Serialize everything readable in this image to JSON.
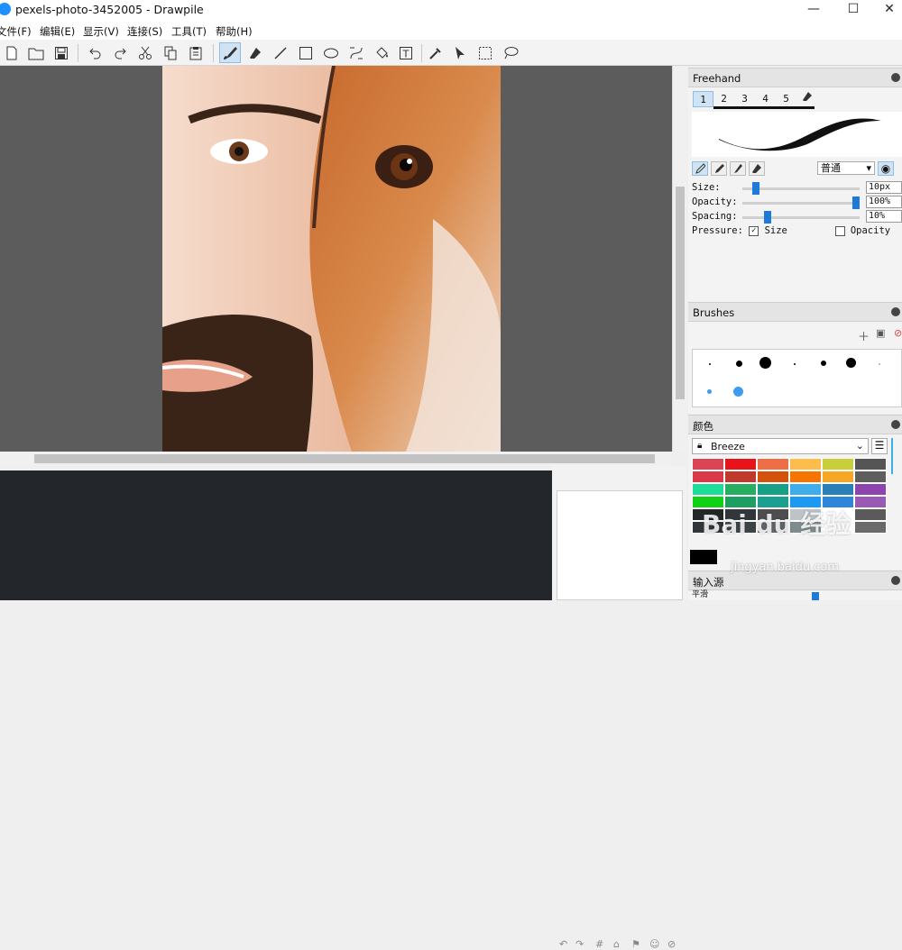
{
  "window": {
    "title": "pexels-photo-3452005 - Drawpile",
    "minimize": "—",
    "maximize": "☐",
    "close": "✕"
  },
  "menu": [
    "文件(F)",
    "编辑(E)",
    "显示(V)",
    "连接(S)",
    "工具(T)",
    "帮助(H)"
  ],
  "toolbar": {
    "file_tools": [
      "new-document",
      "open-folder",
      "save"
    ],
    "edit_tools": [
      "undo",
      "redo",
      "cut",
      "copy",
      "paste"
    ],
    "draw_tools": [
      "freehand-brush",
      "eraser",
      "line",
      "rectangle",
      "ellipse",
      "bezier",
      "flood-fill",
      "text"
    ],
    "misc_tools": [
      "color-picker",
      "pointer",
      "selection",
      "lasso"
    ],
    "active_tool": "freehand-brush",
    "text_tool_glyph": "T"
  },
  "freehand": {
    "title": "Freehand",
    "tabs": [
      "1",
      "2",
      "3",
      "4",
      "5"
    ],
    "active_tab": "1",
    "blend_mode": "普通",
    "size_label": "Size:",
    "size_value": "10px",
    "size_level": 0.09,
    "opacity_label": "Opacity:",
    "opacity_value": "100%",
    "opacity_level": 1.0,
    "spacing_label": "Spacing:",
    "spacing_value": "10%",
    "spacing_level": 0.2,
    "pressure_label": "Pressure:",
    "pressure_size_label": "Size",
    "pressure_size_checked": true,
    "pressure_opacity_label": "Opacity",
    "pressure_opacity_checked": false
  },
  "brushes": {
    "title": "Brushes"
  },
  "color": {
    "title": "颜色",
    "palette_name": "Breeze",
    "swatches": [
      [
        "#da4453",
        "#e8141a",
        "#ee6e45",
        "#fdbc4b",
        "#c9ce3b",
        "#555555"
      ],
      [
        "#da3948",
        "#c0392b",
        "#d5520c",
        "#f67400",
        "#f6a723",
        "#5e5e5e"
      ],
      [
        "#1cdc9a",
        "#27ae60",
        "#16a085",
        "#3daee9",
        "#2980b9",
        "#8e44ad"
      ],
      [
        "#11d116",
        "#1d9f62",
        "#1a9f90",
        "#1d99f3",
        "#2c87d8",
        "#9b59b6"
      ],
      [
        "#232627",
        "#31363b",
        "#4d4d4d",
        "#bdc3c7",
        "#ffffff",
        "#5a5a5a"
      ],
      [
        "#31363b",
        "#3c4347",
        "#5e666b",
        "#7f8c8d",
        "#fcfcfc",
        "#6a6a6a"
      ]
    ]
  },
  "input": {
    "title": "输入源",
    "smoothing_label": "平滑"
  },
  "watermark": {
    "main": "Bai du 经验",
    "sub": "jingyan.baidu.com"
  }
}
